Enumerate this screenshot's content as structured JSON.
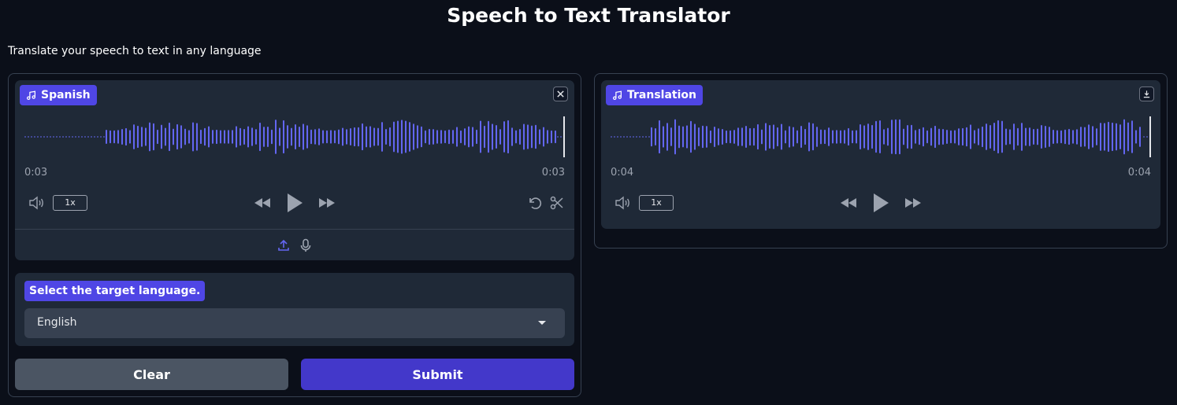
{
  "header": {
    "title": "Speech to Text Translator",
    "subtitle": "Translate your speech to text in any language"
  },
  "input_audio": {
    "label": "Spanish",
    "label_icon": "music-note-icon",
    "current_time": "0:03",
    "duration": "0:03",
    "speed": "1x",
    "waveform_color": "#6366f1"
  },
  "language_select": {
    "label": "Select the target language.",
    "value": "English"
  },
  "output_audio": {
    "label": "Translation",
    "label_icon": "music-note-icon",
    "current_time": "0:04",
    "duration": "0:04",
    "speed": "1x",
    "waveform_color": "#6366f1"
  },
  "buttons": {
    "clear": "Clear",
    "submit": "Submit"
  },
  "colors": {
    "accent": "#4f46e5",
    "background": "#0b0f19",
    "panel": "#1f2937"
  }
}
